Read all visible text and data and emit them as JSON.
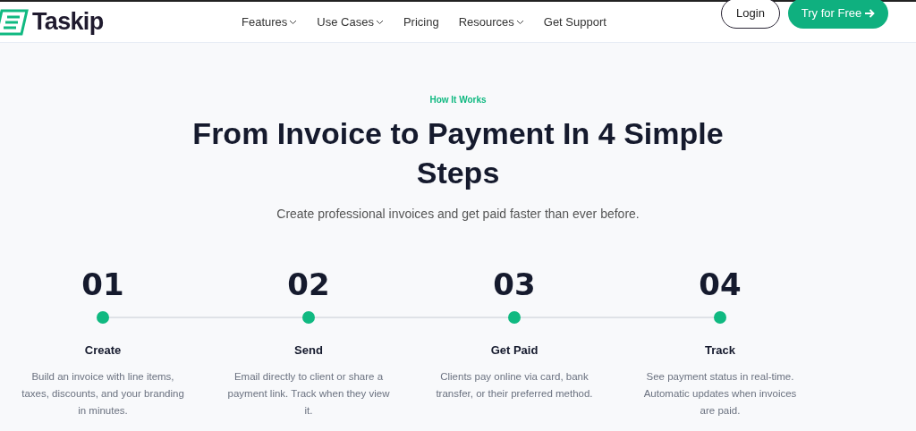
{
  "header": {
    "logo": "Taskip",
    "nav": [
      {
        "label": "Features",
        "dropdown": true
      },
      {
        "label": "Use Cases",
        "dropdown": true
      },
      {
        "label": "Pricing",
        "dropdown": false
      },
      {
        "label": "Resources",
        "dropdown": true
      },
      {
        "label": "Get Support",
        "dropdown": false
      }
    ],
    "login": "Login",
    "cta": "Try for Free"
  },
  "section": {
    "eyebrow": "How It Works",
    "title": "From Invoice to Payment In 4 Simple Steps",
    "subtitle": "Create professional invoices and get paid faster than ever before.",
    "steps": [
      {
        "number": "01",
        "title": "Create",
        "text": "Build an invoice with line items, taxes, discounts, and your branding in minutes."
      },
      {
        "number": "02",
        "title": "Send",
        "text": "Email directly to client or share a payment link. Track when they view it."
      },
      {
        "number": "03",
        "title": "Get Paid",
        "text": "Clients pay online via card, bank transfer, or their preferred method."
      },
      {
        "number": "04",
        "title": "Track",
        "text": "See payment status in real-time. Automatic updates when invoices are paid."
      }
    ]
  }
}
